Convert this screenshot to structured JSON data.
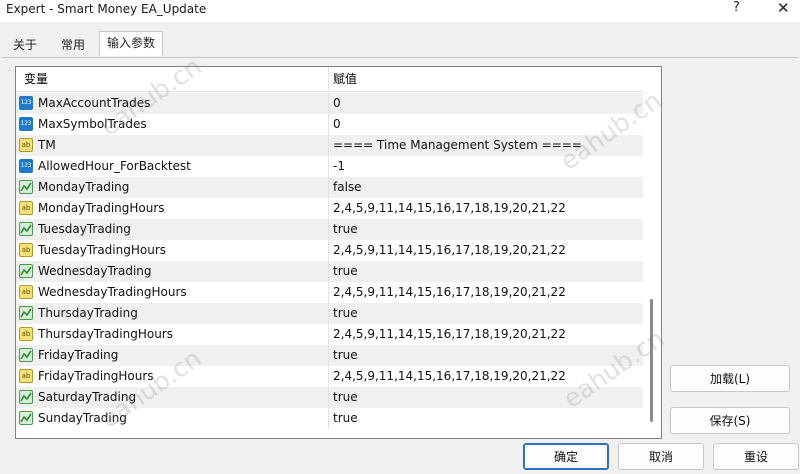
{
  "window": {
    "title": "Expert - Smart Money EA_Update",
    "help_label": "?",
    "close_label": "✕"
  },
  "tabs": [
    {
      "label": "关于"
    },
    {
      "label": "常用"
    },
    {
      "label": "输入参数",
      "active": true
    }
  ],
  "table": {
    "col_variable": "变量",
    "col_value": "赋值",
    "rows": [
      {
        "icon": "number-icon",
        "name": "MaxAccountTrades",
        "value": "0"
      },
      {
        "icon": "number-icon",
        "name": "MaxSymbolTrades",
        "value": "0"
      },
      {
        "icon": "string-icon",
        "name": "TM",
        "value": "==== Time Management System ===="
      },
      {
        "icon": "number-icon",
        "name": "AllowedHour_ForBacktest",
        "value": "-1"
      },
      {
        "icon": "boolean-icon",
        "name": "MondayTrading",
        "value": "false"
      },
      {
        "icon": "string-icon",
        "name": "MondayTradingHours",
        "value": "2,4,5,9,11,14,15,16,17,18,19,20,21,22"
      },
      {
        "icon": "boolean-icon",
        "name": "TuesdayTrading",
        "value": "true"
      },
      {
        "icon": "string-icon",
        "name": "TuesdayTradingHours",
        "value": "2,4,5,9,11,14,15,16,17,18,19,20,21,22"
      },
      {
        "icon": "boolean-icon",
        "name": "WednesdayTrading",
        "value": "true"
      },
      {
        "icon": "string-icon",
        "name": "WednesdayTradingHours",
        "value": "2,4,5,9,11,14,15,16,17,18,19,20,21,22"
      },
      {
        "icon": "boolean-icon",
        "name": "ThursdayTrading",
        "value": "true"
      },
      {
        "icon": "string-icon",
        "name": "ThursdayTradingHours",
        "value": "2,4,5,9,11,14,15,16,17,18,19,20,21,22"
      },
      {
        "icon": "boolean-icon",
        "name": "FridayTrading",
        "value": "true"
      },
      {
        "icon": "string-icon",
        "name": "FridayTradingHours",
        "value": "2,4,5,9,11,14,15,16,17,18,19,20,21,22"
      },
      {
        "icon": "boolean-icon",
        "name": "SaturdayTrading",
        "value": "true"
      },
      {
        "icon": "boolean-icon",
        "name": "SundayTrading",
        "value": "true"
      }
    ]
  },
  "icon_text": {
    "number": "123",
    "string": "ab"
  },
  "buttons": {
    "load": "加载(L)",
    "save": "保存(S)",
    "ok": "确定",
    "cancel": "取消",
    "reset": "重设"
  },
  "watermark": "eahub.cn",
  "colors": {
    "accent_button_border": "#2f6fbf",
    "alt_row": "#f0f0f0"
  }
}
